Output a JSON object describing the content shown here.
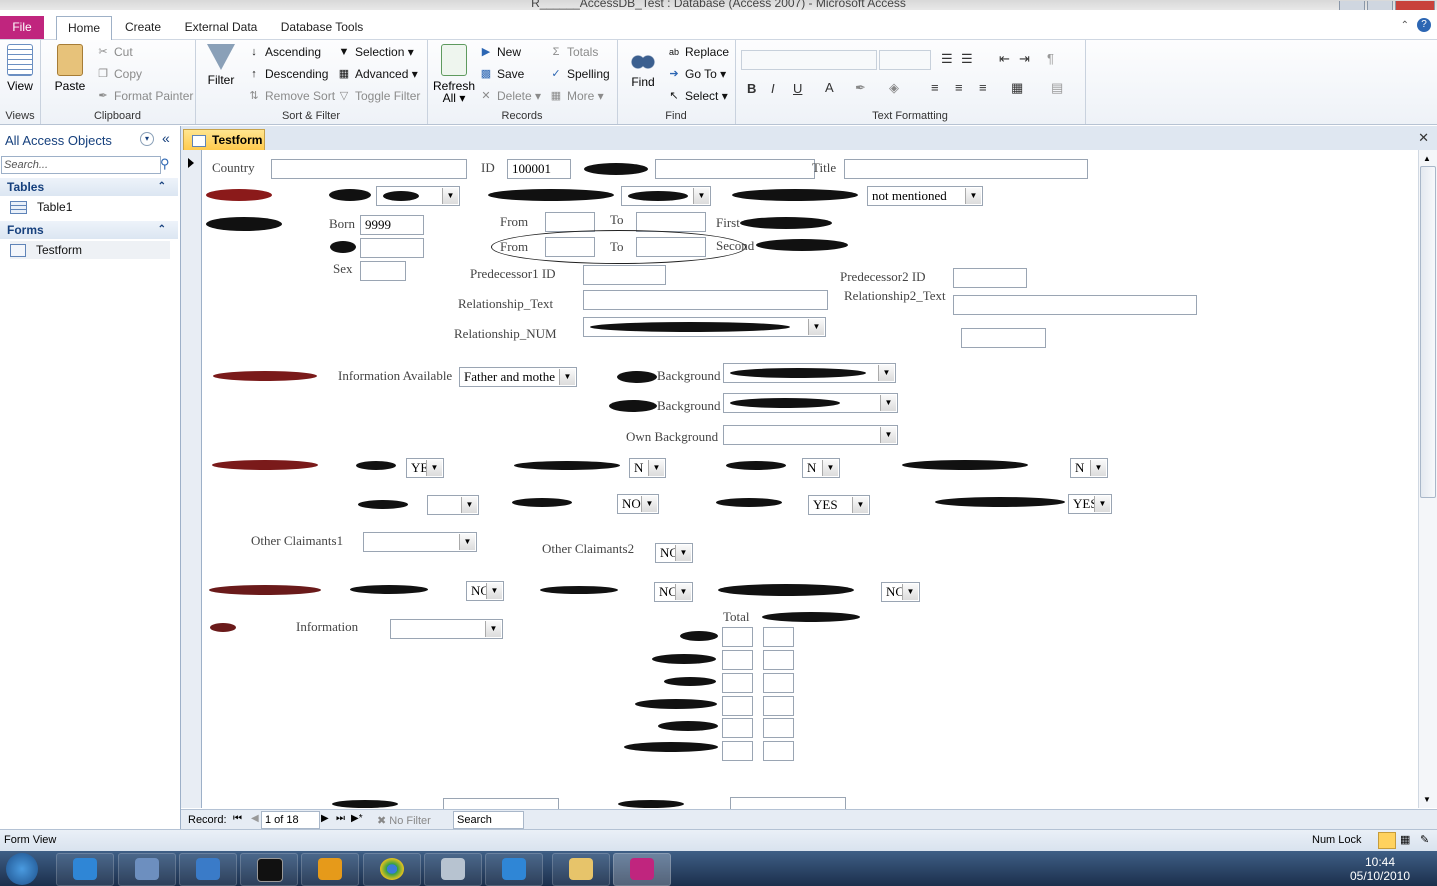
{
  "window": {
    "title": "R______AccessDB_Test : Database (Access 2007) - Microsoft Access"
  },
  "ribbon_tabs": [
    "File",
    "Home",
    "Create",
    "External Data",
    "Database Tools"
  ],
  "ribbon": {
    "views": {
      "view": "View",
      "group": "Views"
    },
    "clipboard": {
      "paste": "Paste",
      "cut": "Cut",
      "copy": "Copy",
      "format_painter": "Format Painter",
      "group": "Clipboard"
    },
    "sort_filter": {
      "filter": "Filter",
      "ascending": "Ascending",
      "descending": "Descending",
      "remove_sort": "Remove Sort",
      "selection": "Selection",
      "advanced": "Advanced",
      "toggle_filter": "Toggle Filter",
      "group": "Sort & Filter"
    },
    "records": {
      "refresh": "Refresh",
      "refresh_all": "All",
      "new": "New",
      "save": "Save",
      "delete": "Delete",
      "totals": "Totals",
      "spelling": "Spelling",
      "more": "More",
      "group": "Records"
    },
    "find": {
      "find": "Find",
      "replace": "Replace",
      "goto": "Go To",
      "select": "Select",
      "group": "Find"
    },
    "text_formatting": {
      "group": "Text Formatting",
      "bold": "B",
      "italic": "I",
      "underline": "U"
    }
  },
  "nav": {
    "header": "All Access Objects",
    "search_placeholder": "Search...",
    "sections": [
      {
        "title": "Tables",
        "items": [
          "Table1"
        ]
      },
      {
        "title": "Forms",
        "items": [
          "Testform"
        ]
      }
    ]
  },
  "doc_tab": "Testform",
  "form": {
    "country_label": "Country",
    "id_label": "ID",
    "id_value": "100001",
    "title_label": "Title",
    "info_value": "not mentioned",
    "born_label": "Born",
    "born_value": "9999",
    "sex_label": "Sex",
    "from_label": "From",
    "to_label": "To",
    "first_label": "First",
    "second_label": "Second",
    "pred1_label": "Predecessor1 ID",
    "pred2_label": "Predecessor2 ID",
    "rel_text_label": "Relationship_Text",
    "rel2_text_label": "Relationship2_Text",
    "rel_num_label": "Relationship_NUM",
    "info_avail_label": "Information Available",
    "info_avail_value": "Father and mothe",
    "background_label": "Background",
    "own_background_label": "Own Background",
    "yes_short": "YE",
    "no_short": "N",
    "no_value": "NO",
    "yes_value": "YES",
    "nc_value": "NC",
    "other_claimants1": "Other Claimants1",
    "other_claimants2": "Other Claimants2",
    "information_label": "Information",
    "total_label": "Total"
  },
  "record_nav": {
    "record_label": "Record:",
    "position": "1 of 18",
    "filter": "No Filter",
    "search": "Search"
  },
  "status": {
    "left": "Form View",
    "numlock": "Num Lock"
  },
  "taskbar": {
    "time": "10:44",
    "date": "05/10/2010"
  },
  "colors": {
    "file_tab": "#c0257e",
    "doc_tab": "#ffc94a",
    "taskbar": "#1b2f4c"
  }
}
